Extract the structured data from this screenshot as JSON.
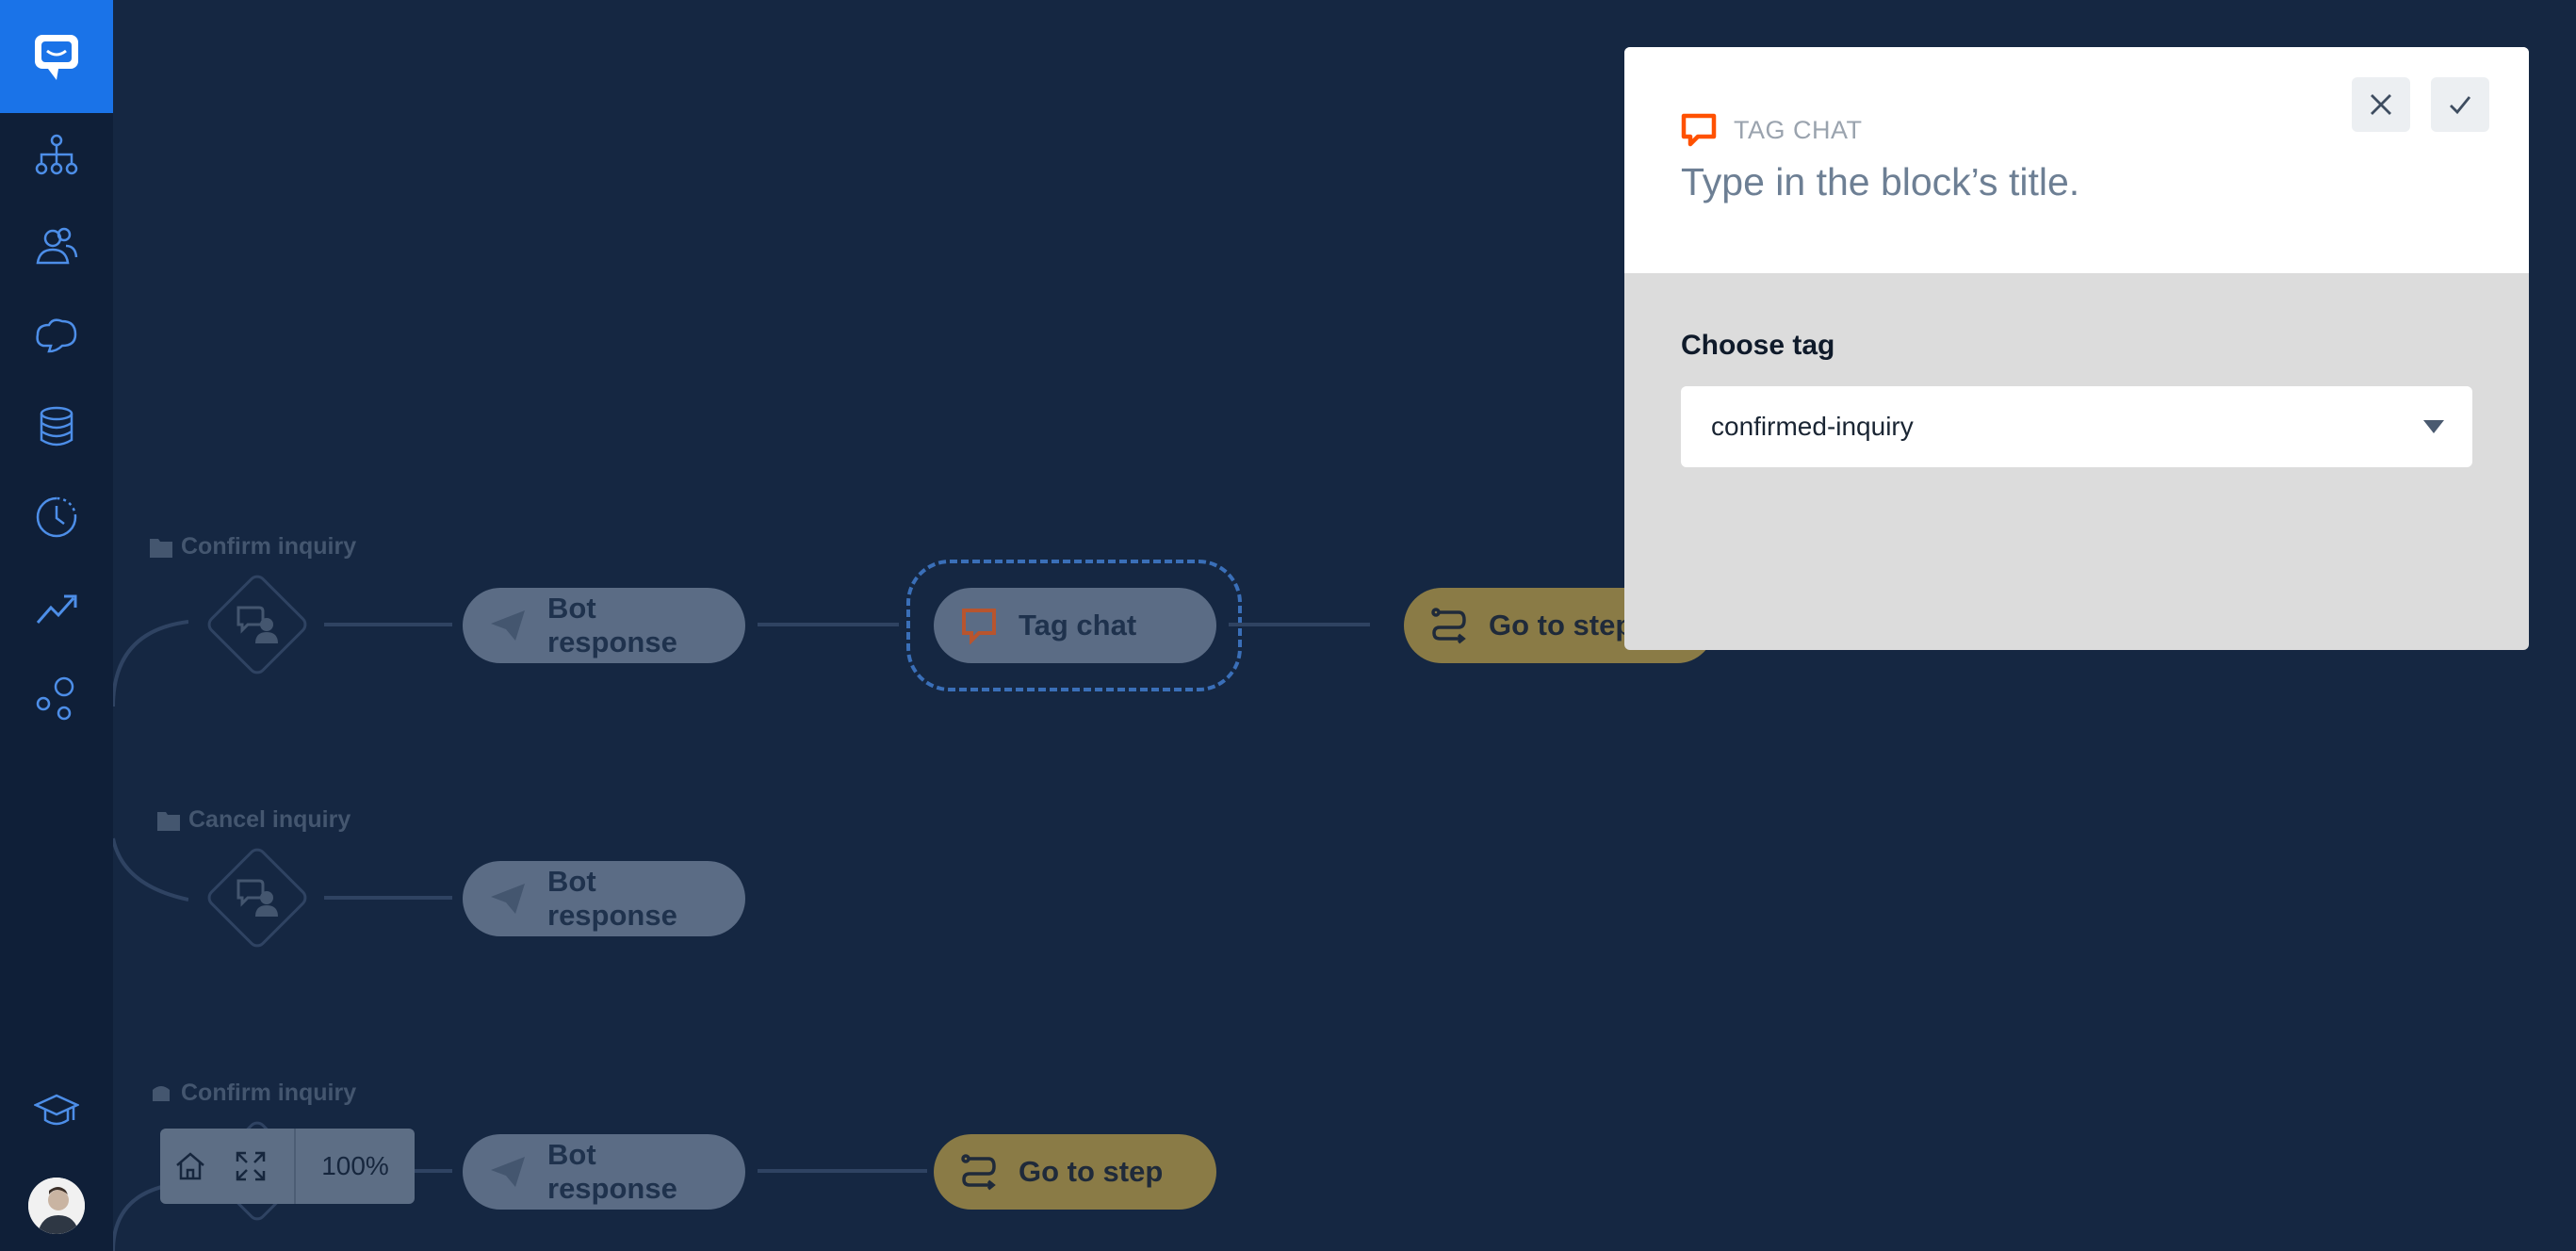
{
  "sidebar": {
    "items": [
      {
        "name": "flows",
        "icon": "sitemap-icon"
      },
      {
        "name": "users",
        "icon": "users-icon"
      },
      {
        "name": "stories",
        "icon": "chat-cloud-icon"
      },
      {
        "name": "data",
        "icon": "database-icon"
      },
      {
        "name": "history",
        "icon": "clock-icon"
      },
      {
        "name": "reports",
        "icon": "trend-icon"
      },
      {
        "name": "integrations",
        "icon": "nodes-icon"
      },
      {
        "name": "academy",
        "icon": "graduation-cap-icon"
      }
    ]
  },
  "canvas": {
    "rows": [
      {
        "label": "Confirm inquiry",
        "bot": "Bot response",
        "tag": "Tag chat",
        "goto": "Go to step"
      },
      {
        "label": "Cancel inquiry",
        "bot": "Bot response"
      },
      {
        "label": "Confirm inquiry",
        "bot": "Bot response",
        "goto": "Go to step"
      }
    ]
  },
  "zoom": {
    "value": "100%"
  },
  "panel": {
    "kind": "TAG CHAT",
    "title_placeholder": "Type in the block’s title.",
    "choose_label": "Choose tag",
    "selected_tag": "confirmed-inquiry"
  },
  "colors": {
    "background": "#152742",
    "sidebar": "#0f1f38",
    "logo_accent": "#1a73e8",
    "tag_accent": "#ff5100",
    "goto_pill": "#8a7b46"
  }
}
